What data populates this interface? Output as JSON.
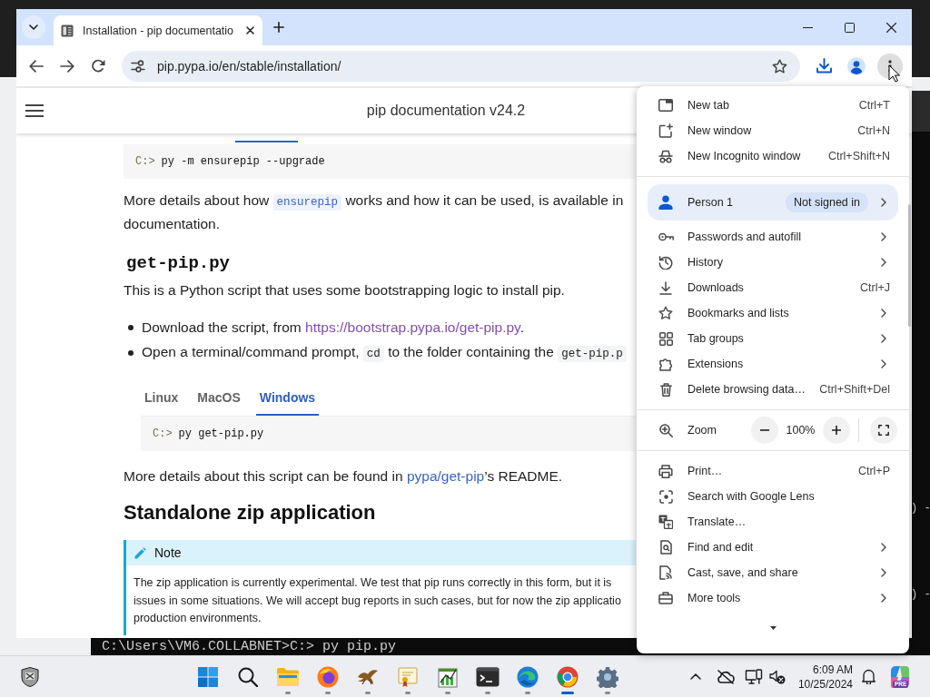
{
  "desktop": {
    "terminal": {
      "prompt_line": "C:\\Users\\VM6.COLLABNET>C:> py pip.py",
      "edge_fragments": [
        ") -",
        ") -"
      ]
    }
  },
  "browser": {
    "tabs": [
      {
        "title": "Installation - pip documentatio",
        "selected": true
      }
    ],
    "address_bar": {
      "url": "pip.pypa.io/en/stable/installation/"
    },
    "menu_button": {
      "pressed": true
    }
  },
  "page": {
    "header_title": "pip documentation v24.2",
    "content": [
      {
        "kind": "code",
        "prompt": "C:>",
        "command": "py -m ensurepip --upgrade"
      },
      {
        "kind": "paragraph",
        "lines": [
          [
            {
              "kind": "text",
              "text": "More details about how "
            },
            {
              "kind": "link",
              "text": "ensurepip",
              "code": true,
              "visited": false
            },
            {
              "kind": "text",
              "text": " works and how it can be used, is available in"
            }
          ],
          [
            {
              "kind": "text",
              "text": "documentation."
            }
          ]
        ]
      },
      {
        "kind": "code_heading",
        "text": "get-pip.py"
      },
      {
        "kind": "paragraph",
        "lines": [
          [
            {
              "kind": "text",
              "text": "This is a Python script that uses some bootstrapping logic to install pip."
            }
          ]
        ]
      },
      {
        "kind": "bullets",
        "items": [
          [
            {
              "kind": "text",
              "text": "Download the script, from "
            },
            {
              "kind": "link",
              "text": "https://bootstrap.pypa.io/get-pip.py",
              "code": false,
              "visited": true
            },
            {
              "kind": "text",
              "text": "."
            }
          ],
          [
            {
              "kind": "text",
              "text": "Open a terminal/command prompt, "
            },
            {
              "kind": "code",
              "text": "cd"
            },
            {
              "kind": "text",
              "text": " to the folder containing the "
            },
            {
              "kind": "code",
              "text": "get-pip.p"
            }
          ]
        ]
      },
      {
        "kind": "tab_set",
        "tabs": [
          {
            "label": "Linux",
            "selected": false
          },
          {
            "label": "MacOS",
            "selected": false
          },
          {
            "label": "Windows",
            "selected": true
          }
        ],
        "code": {
          "prompt": "C:>",
          "command": "py get-pip.py"
        }
      },
      {
        "kind": "paragraph",
        "lines": [
          [
            {
              "kind": "text",
              "text": "More details about this script can be found in "
            },
            {
              "kind": "link",
              "text": "pypa/get-pip",
              "code": false,
              "visited": false
            },
            {
              "kind": "text",
              "text": "’s README."
            }
          ]
        ]
      },
      {
        "kind": "heading",
        "text": "Standalone zip application"
      },
      {
        "kind": "note",
        "title": "Note",
        "lines": [
          "The zip application is currently experimental. We test that pip runs correctly in this form, but it is",
          "issues in some situations. We will accept bug reports in such cases, but for now the zip applicatio",
          "production environments."
        ]
      }
    ]
  },
  "menu": {
    "sections": [
      [
        {
          "kind": "shortcut",
          "label": "New tab",
          "shortcut": "Ctrl+T"
        },
        {
          "kind": "shortcut",
          "label": "New window",
          "shortcut": "Ctrl+N"
        },
        {
          "kind": "shortcut",
          "label": "New Incognito window",
          "shortcut": "Ctrl+Shift+N"
        }
      ],
      [
        {
          "kind": "profile",
          "label": "Person 1",
          "status": "Not signed in"
        },
        {
          "kind": "submenu",
          "label": "Passwords and autofill"
        },
        {
          "kind": "submenu",
          "label": "History"
        },
        {
          "kind": "shortcut",
          "label": "Downloads",
          "shortcut": "Ctrl+J"
        },
        {
          "kind": "submenu",
          "label": "Bookmarks and lists"
        },
        {
          "kind": "submenu",
          "label": "Tab groups"
        },
        {
          "kind": "submenu",
          "label": "Extensions"
        },
        {
          "kind": "shortcut",
          "label": "Delete browsing data…",
          "shortcut": "Ctrl+Shift+Del"
        }
      ],
      [
        {
          "kind": "zoom",
          "label": "Zoom",
          "value": "100%"
        }
      ],
      [
        {
          "kind": "shortcut",
          "label": "Print…",
          "shortcut": "Ctrl+P"
        },
        {
          "kind": "plain",
          "label": "Search with Google Lens"
        },
        {
          "kind": "plain",
          "label": "Translate…"
        },
        {
          "kind": "submenu",
          "label": "Find and edit"
        },
        {
          "kind": "submenu",
          "label": "Cast, save, and share"
        },
        {
          "kind": "submenu",
          "label": "More tools"
        }
      ]
    ]
  },
  "taskbar": {
    "apps": [
      {
        "running": true,
        "active": false
      },
      {
        "running": true,
        "active": false
      },
      {
        "running": true,
        "active": false
      },
      {
        "running": true,
        "active": false
      },
      {
        "running": true,
        "active": false
      },
      {
        "running": true,
        "active": false
      },
      {
        "running": true,
        "active": false
      },
      {
        "running": true,
        "active": true
      },
      {
        "running": true,
        "active": false
      }
    ],
    "clock": {
      "time": "6:09 AM",
      "date": "10/25/2024"
    },
    "copilot_badge": "PRE"
  }
}
